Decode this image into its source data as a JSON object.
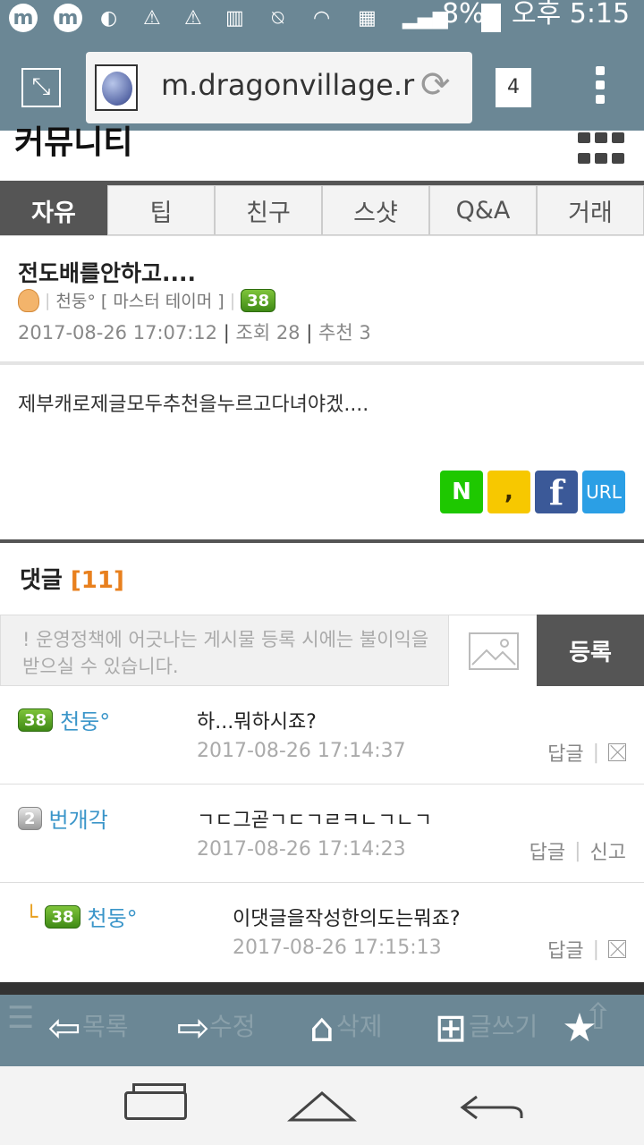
{
  "status_bar": {
    "battery": "8%",
    "time": "오후 5:15"
  },
  "browser": {
    "url": "m.dragonvillage.r",
    "tab_count": "4"
  },
  "page": {
    "title": "커뮤니티"
  },
  "tabs": [
    {
      "label": "자유",
      "active": true
    },
    {
      "label": "팁",
      "active": false
    },
    {
      "label": "친구",
      "active": false
    },
    {
      "label": "스샷",
      "active": false
    },
    {
      "label": "Q&A",
      "active": false
    },
    {
      "label": "거래",
      "active": false
    }
  ],
  "post": {
    "title": "전도배를안하고....",
    "author": "천둥°",
    "author_title": "[ 마스터 테이머 ]",
    "level": "38",
    "datetime": "2017-08-26 17:07:12",
    "views": "조회 28",
    "recommends": "추천 3",
    "body": "제부캐로제글모두추천을누르고다녀야겠...."
  },
  "share": {
    "naver": "N",
    "kakao": ",",
    "facebook": "f",
    "url": "URL"
  },
  "comments_section": {
    "label": "댓글",
    "count": "[11]",
    "placeholder": "! 운영정책에 어긋나는 게시물 등록 시에는 불이익을 받으실 수 있습니다.",
    "submit": "등록"
  },
  "comments": [
    {
      "level": "38",
      "author": "천둥°",
      "text": "하...뭐하시죠?",
      "datetime": "2017-08-26 17:14:37",
      "reply": "답글"
    },
    {
      "level": "2",
      "author": "번개각",
      "text": "ㄱㄷ그곧ㄱㄷㄱㄹㅋㄴㄱㄴㄱ",
      "datetime": "2017-08-26 17:14:23",
      "reply": "답글",
      "report": "신고"
    },
    {
      "level": "38",
      "author": "천둥°",
      "text": "이댓글을작성한의도는뭐죠?",
      "datetime": "2017-08-26 17:15:13",
      "reply": "답글",
      "is_reply": true
    }
  ],
  "toolbar": {
    "list": "목록",
    "edit": "수정",
    "delete": "삭제",
    "write": "글쓰기"
  }
}
